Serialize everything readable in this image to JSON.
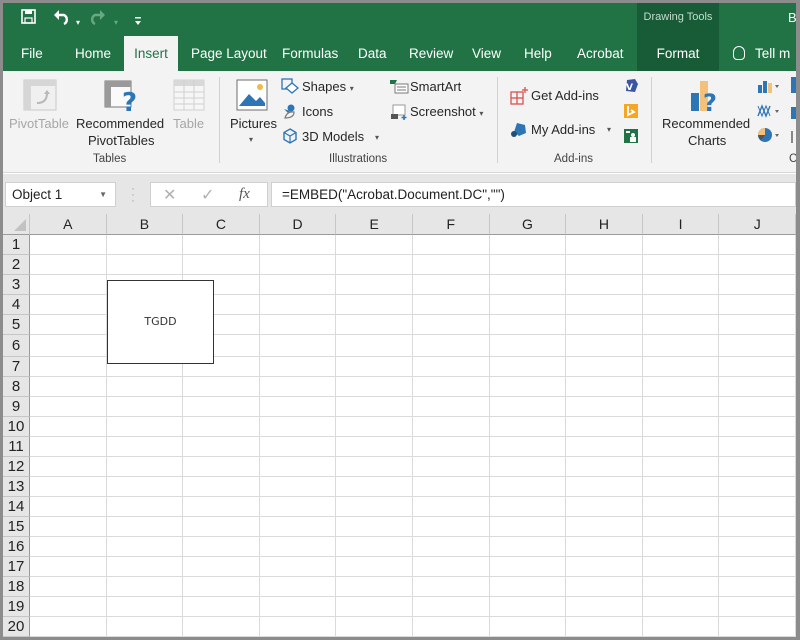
{
  "quick_access": {
    "save_icon": "save-icon",
    "undo_icon": "undo-icon",
    "redo_icon": "redo-icon",
    "customize_icon": "customize-qat-icon"
  },
  "contextual": {
    "title": "Drawing Tools",
    "user_initial": "B"
  },
  "tabs": [
    {
      "label": "File"
    },
    {
      "label": "Home"
    },
    {
      "label": "Insert"
    },
    {
      "label": "Page Layout"
    },
    {
      "label": "Formulas"
    },
    {
      "label": "Data"
    },
    {
      "label": "Review"
    },
    {
      "label": "View"
    },
    {
      "label": "Help"
    },
    {
      "label": "Acrobat"
    },
    {
      "label": "Format"
    }
  ],
  "active_tab": "Insert",
  "tell_me": "Tell m",
  "ribbon": {
    "tables": {
      "label": "Tables",
      "pivot_table": "PivotTable",
      "recommended_pivot_1": "Recommended",
      "recommended_pivot_2": "PivotTables",
      "table": "Table"
    },
    "illustrations": {
      "label": "Illustrations",
      "pictures": "Pictures",
      "shapes": "Shapes",
      "icons": "Icons",
      "models": "3D Models",
      "smartart": "SmartArt",
      "screenshot": "Screenshot"
    },
    "addins": {
      "label": "Add-ins",
      "get": "Get Add-ins",
      "my": "My Add-ins"
    },
    "charts": {
      "label": "Ch",
      "recommended_1": "Recommended",
      "recommended_2": "Charts"
    }
  },
  "formula_bar": {
    "name_box": "Object 1",
    "cancel": "✕",
    "enter": "✓",
    "fx": "fx",
    "formula": "=EMBED(\"Acrobat.Document.DC\",\"\")"
  },
  "sheet": {
    "columns": [
      "A",
      "B",
      "C",
      "D",
      "E",
      "F",
      "G",
      "H",
      "I",
      "J"
    ],
    "rows": [
      "1",
      "2",
      "3",
      "4",
      "5",
      "6",
      "7",
      "8",
      "9",
      "10",
      "11",
      "12",
      "13",
      "14",
      "15",
      "16",
      "17",
      "18",
      "19",
      "20"
    ],
    "embedded_object_label": "TGDD"
  }
}
